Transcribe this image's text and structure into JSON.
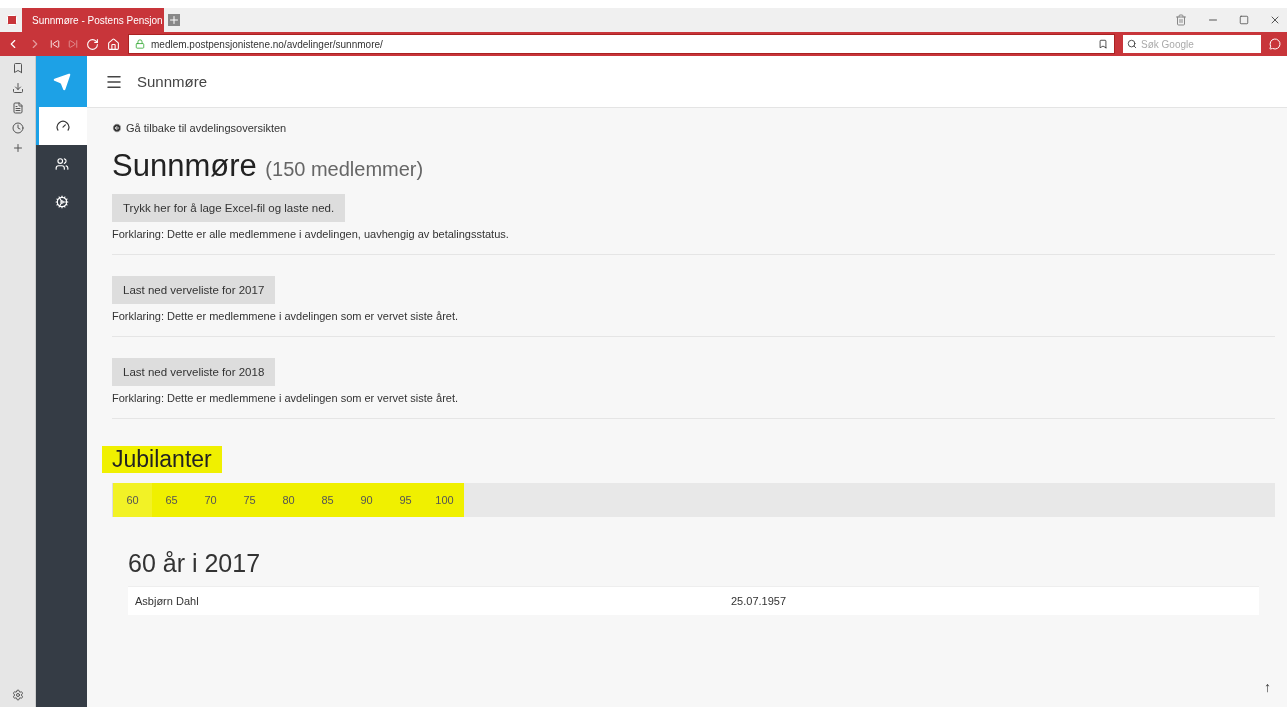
{
  "browser": {
    "tab_title": "Sunnmøre - Postens Pensjon",
    "url": "medlem.postpensjonistene.no/avdelinger/sunnmore/",
    "search_placeholder": "Søk Google"
  },
  "sidebar": {
    "items": [
      {
        "selected": true
      },
      {
        "selected": false
      },
      {
        "selected": false
      }
    ]
  },
  "header": {
    "title": "Sunnmøre"
  },
  "back_link": "Gå tilbake til avdelingsoversikten",
  "page_title": "Sunnmøre",
  "member_count": "(150 medlemmer)",
  "downloads": [
    {
      "button": "Trykk her for å lage Excel-fil og laste ned.",
      "explanation": "Forklaring: Dette er alle medlemmene i avdelingen, uavhengig av betalingsstatus."
    },
    {
      "button": "Last ned verveliste for 2017",
      "explanation": "Forklaring: Dette er medlemmene i avdelingen som er vervet siste året."
    },
    {
      "button": "Last ned verveliste for 2018",
      "explanation": "Forklaring: Dette er medlemmene i avdelingen som er vervet siste året."
    }
  ],
  "jubilees": {
    "title": "Jubilanter",
    "highlighted": true,
    "tabs": [
      {
        "label": "60",
        "selected": true
      },
      {
        "label": "65",
        "selected": false
      },
      {
        "label": "70",
        "selected": false
      },
      {
        "label": "75",
        "selected": false
      },
      {
        "label": "80",
        "selected": false
      },
      {
        "label": "85",
        "selected": false
      },
      {
        "label": "90",
        "selected": false
      },
      {
        "label": "95",
        "selected": false
      },
      {
        "label": "100",
        "selected": false
      }
    ],
    "section_title": "60 år i 2017",
    "rows": [
      {
        "name": "Asbjørn Dahl",
        "date": "25.07.1957"
      }
    ]
  },
  "scroll_top": "↑"
}
